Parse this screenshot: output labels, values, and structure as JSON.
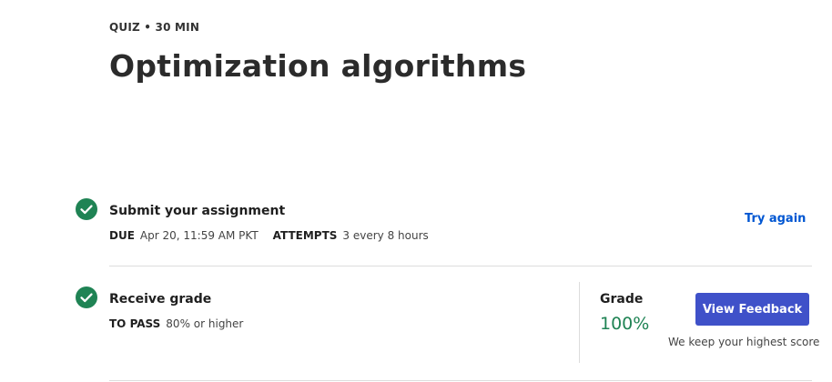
{
  "header": {
    "kicker": "QUIZ • 30 MIN",
    "title": "Optimization algorithms"
  },
  "steps": [
    {
      "title": "Submit your assignment",
      "due_label": "DUE",
      "due_value": "Apr 20, 11:59 AM PKT",
      "attempts_label": "ATTEMPTS",
      "attempts_value": "3 every 8 hours",
      "action_label": "Try again",
      "status_icon": "check-circle-icon"
    },
    {
      "title": "Receive grade",
      "topass_label": "TO PASS",
      "topass_value": "80% or higher",
      "status_icon": "check-circle-icon"
    }
  ],
  "grade": {
    "label": "Grade",
    "value": "100%",
    "button_label": "View Feedback",
    "note": "We keep your highest score"
  },
  "colors": {
    "success": "#1f8354",
    "primary": "#3f51c9",
    "link": "#0056d2"
  }
}
